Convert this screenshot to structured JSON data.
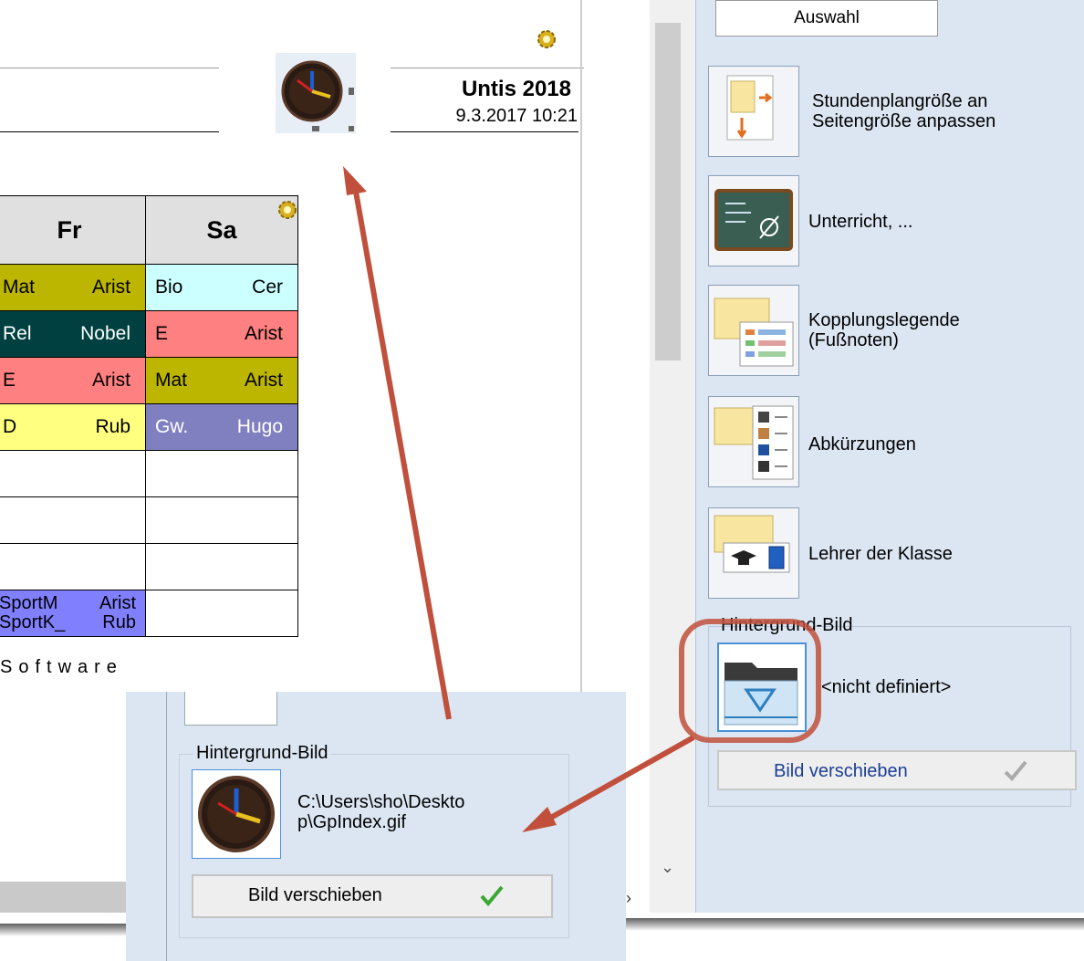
{
  "header": {
    "title": "Untis 2018",
    "datetime": "9.3.2017  10:21"
  },
  "timetable": {
    "columns": [
      "Fr",
      "Sa"
    ],
    "rows": [
      {
        "fr": [
          "Mat",
          "Arist"
        ],
        "sa": [
          "Bio",
          "Cer"
        ],
        "fr_color": "#bdb600",
        "sa_color": "#ccffff",
        "fr_text": "#000000",
        "sa_text": "#000000"
      },
      {
        "fr": [
          "Rel",
          "Nobel"
        ],
        "sa": [
          "E",
          "Arist"
        ],
        "fr_color": "#004040",
        "sa_color": "#ff8080",
        "fr_text": "#ffffff",
        "sa_text": "#000000"
      },
      {
        "fr": [
          "E",
          "Arist"
        ],
        "sa": [
          "Mat",
          "Arist"
        ],
        "fr_color": "#ff8080",
        "sa_color": "#bdb600",
        "fr_text": "#000000",
        "sa_text": "#000000"
      },
      {
        "fr": [
          "D",
          "Rub"
        ],
        "sa": [
          "Gw.",
          "Hugo"
        ],
        "fr_color": "#ffff80",
        "sa_color": "#8080c0",
        "fr_text": "#000000",
        "sa_text": "#ffffff"
      },
      {
        "fr": [
          "",
          ""
        ],
        "sa": [
          "",
          ""
        ]
      },
      {
        "fr": [
          "",
          ""
        ],
        "sa": [
          "",
          ""
        ]
      },
      {
        "fr": [
          "",
          ""
        ],
        "sa": [
          "",
          ""
        ]
      }
    ],
    "last_row": {
      "line1": [
        "SportM",
        "Arist"
      ],
      "line2": [
        "SportK_",
        "Rub"
      ],
      "color": "#8080ff"
    }
  },
  "footer_text": "Software",
  "right_panel": {
    "auswahl_label": "Auswahl",
    "items": [
      {
        "label_line1": "Stundenplangröße an",
        "label_line2": "Seitengröße anpassen"
      },
      {
        "label_line1": "Unterricht, ...",
        "label_line2": ""
      },
      {
        "label_line1": "Kopplungslegende",
        "label_line2": "(Fußnoten)"
      },
      {
        "label_line1": "Abkürzungen",
        "label_line2": ""
      },
      {
        "label_line1": "Lehrer der Klasse",
        "label_line2": ""
      }
    ],
    "background_group": "Hintergrund-Bild",
    "background_value": "<nicht definiert>",
    "move_button": "Bild verschieben"
  },
  "callout": {
    "background_group": "Hintergrund-Bild",
    "path_line1": "C:\\Users\\sho\\Deskto",
    "path_line2": "p\\GpIndex.gif",
    "move_button": "Bild verschieben"
  },
  "colors": {
    "arrow": "#c0503c",
    "panel_bg": "#dce6f2",
    "highlight_ring": "#c0503c"
  }
}
